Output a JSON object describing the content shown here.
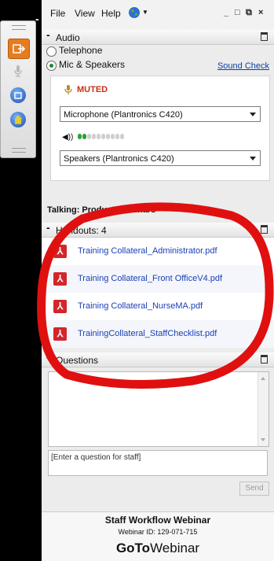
{
  "menu": {
    "file": "File",
    "view": "View",
    "help": "Help"
  },
  "window_buttons": {
    "minimize": "_",
    "maximize": "□",
    "restore": "⧉",
    "close": "×"
  },
  "audio": {
    "title": "Audio",
    "options": [
      {
        "label": "Telephone",
        "selected": false
      },
      {
        "label": "Mic & Speakers",
        "selected": true
      }
    ],
    "sound_check": "Sound Check",
    "muted_label": "MUTED",
    "microphone": "Microphone (Plantronics C420)",
    "speakers": "Speakers (Plantronics C420)",
    "meter_level_segments": 2,
    "meter_total_segments": 10
  },
  "talking_label": "Talking: Product Webinars",
  "handouts": {
    "title": "Handouts: 4",
    "files": [
      "Training Collateral_Administrator.pdf",
      "Training Collateral_Front OfficeV4.pdf",
      "Training Collateral_NurseMA.pdf",
      "TrainingCollateral_StaffChecklist.pdf"
    ]
  },
  "questions": {
    "title": "Questions",
    "placeholder": "[Enter a question for staff]",
    "send_label": "Send"
  },
  "footer": {
    "webinar_title": "Staff Workflow Webinar",
    "webinar_id": "Webinar ID: 129-071-715",
    "brand_bold": "GoTo",
    "brand_light": "Webinar"
  },
  "colors": {
    "accent_orange": "#e77c1e",
    "muted_red": "#c83014",
    "link_blue": "#1b3fb5",
    "pdf_red": "#d2262a",
    "annotation_red": "#e01010"
  }
}
